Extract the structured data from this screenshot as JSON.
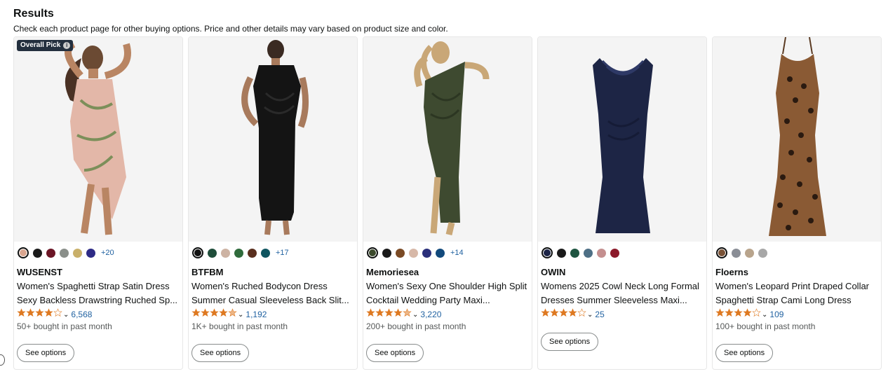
{
  "header": {
    "title": "Results",
    "subtitle": "Check each product page for other buying options. Price and other details may vary based on product size and color."
  },
  "badge": {
    "label": "Overall Pick",
    "icon": "info-icon"
  },
  "products": [
    {
      "brand": "WUSENST",
      "title": "Women's Spaghetti Strap Satin Dress Sexy Backless Drawstring Ruched Sp...",
      "rating": 4.0,
      "review_count": "6,568",
      "bought": "50+ bought in past month",
      "button": "See options",
      "swatches": [
        "#d9a58f",
        "#1a1a1a",
        "#6b1525",
        "#8a8f8a",
        "#c9b06a",
        "#2e2b86"
      ],
      "more": "+20"
    },
    {
      "brand": "BTFBM",
      "title": "Women's Ruched Bodycon Dress Summer Casual Sleeveless Back Slit...",
      "rating": 4.5,
      "review_count": "1,192",
      "bought": "1K+ bought in past month",
      "button": "See options",
      "swatches": [
        "#111111",
        "#1f4d3a",
        "#cdb3a3",
        "#2f6b3c",
        "#5a2f1e",
        "#0f5560"
      ],
      "more": "+17"
    },
    {
      "brand": "Memoriesea",
      "title": "Women's Sexy One Shoulder High Split Cocktail Wedding Party Maxi...",
      "rating": 4.5,
      "review_count": "3,220",
      "bought": "200+ bought in past month",
      "button": "See options",
      "swatches": [
        "#3b4a2c",
        "#1a1a1a",
        "#7a4a25",
        "#d7b8a8",
        "#2a2f7a",
        "#124a7c"
      ],
      "more": "+14"
    },
    {
      "brand": "OWIN",
      "title": "Womens 2025 Cowl Neck Long Formal Dresses Summer Sleeveless Maxi...",
      "rating": 4.0,
      "review_count": "25",
      "bought": "",
      "button": "See options",
      "swatches": [
        "#1c2447",
        "#1a1a1a",
        "#1f5541",
        "#4e6f85",
        "#c48f8f",
        "#8c1a2a"
      ],
      "more": ""
    },
    {
      "brand": "Floerns",
      "title": "Women's Leopard Print Draped Collar Spaghetti Strap Cami Long Dress",
      "rating": 4.0,
      "review_count": "109",
      "bought": "100+ bought in past month",
      "button": "See options",
      "swatches": [
        "#7a5236",
        "#8a8e96",
        "#b8a48c",
        "#a7a7a7"
      ],
      "more": ""
    }
  ],
  "colors": {
    "star": "#de7921",
    "link": "#2162a1",
    "badge_bg": "#232f3e"
  }
}
